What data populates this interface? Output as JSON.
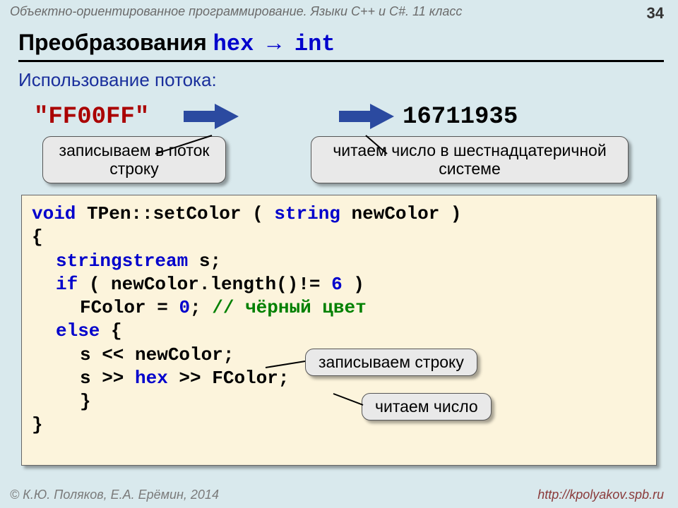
{
  "header": {
    "text": "Объектно-ориентированное программирование. Языки C++ и C#. 11 класс",
    "pageNumber": "34"
  },
  "title": {
    "prefix": "Преобразования ",
    "code1": "hex",
    "arrow": " → ",
    "code2": "int"
  },
  "subtitle": "Использование потока:",
  "example": {
    "hex": "\"FF00FF\"",
    "int": "16711935"
  },
  "callouts": {
    "c1": "записываем в поток строку",
    "c2": "читаем число в шестнадцатеричной системе",
    "c3": "записываем строку",
    "c4": "читаем число"
  },
  "code": {
    "l1a": "void",
    "l1b": " TPen::setColor ( ",
    "l1c": "string",
    "l1d": " newColor )",
    "l2": "{",
    "l3a": "stringstream",
    "l3b": " s;",
    "l4a": "if",
    "l4b": " ( newColor.length()!= ",
    "l4c": "6",
    "l4d": " )",
    "l5a": "FColor = ",
    "l5b": "0",
    "l5c": ";   ",
    "l5d": "// чёрный цвет",
    "l6a": "else",
    "l6b": " {",
    "l7": "s << newColor;",
    "l8a": "s >> ",
    "l8b": "hex",
    "l8c": " >> FColor;",
    "l9": "}",
    "l10": "}"
  },
  "footer": {
    "authors": "© К.Ю. Поляков, Е.А. Ерёмин, 2014",
    "url": "http://kpolyakov.spb.ru"
  }
}
